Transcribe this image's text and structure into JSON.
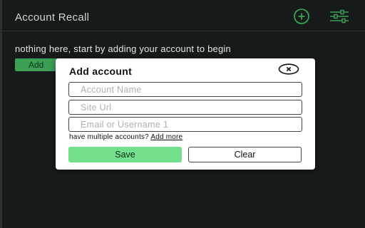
{
  "header": {
    "title": "Account Recall",
    "add_icon": "plus-circle-icon",
    "settings_icon": "sliders-icon"
  },
  "main": {
    "empty_message": "nothing here, start by adding your account to begin",
    "add_button_label": "Add"
  },
  "modal": {
    "title": "Add account",
    "close_icon": "close-circle-icon",
    "fields": {
      "account_name_placeholder": "Account Name",
      "site_url_placeholder": "Site Url",
      "email_placeholder": "Email or Username 1"
    },
    "multi_text": "have multiple accounts?",
    "add_more_label": "Add more",
    "save_label": "Save",
    "clear_label": "Clear"
  },
  "colors": {
    "accent_green": "#3d9f55",
    "save_green": "#74e08d",
    "background": "#161a1a"
  }
}
